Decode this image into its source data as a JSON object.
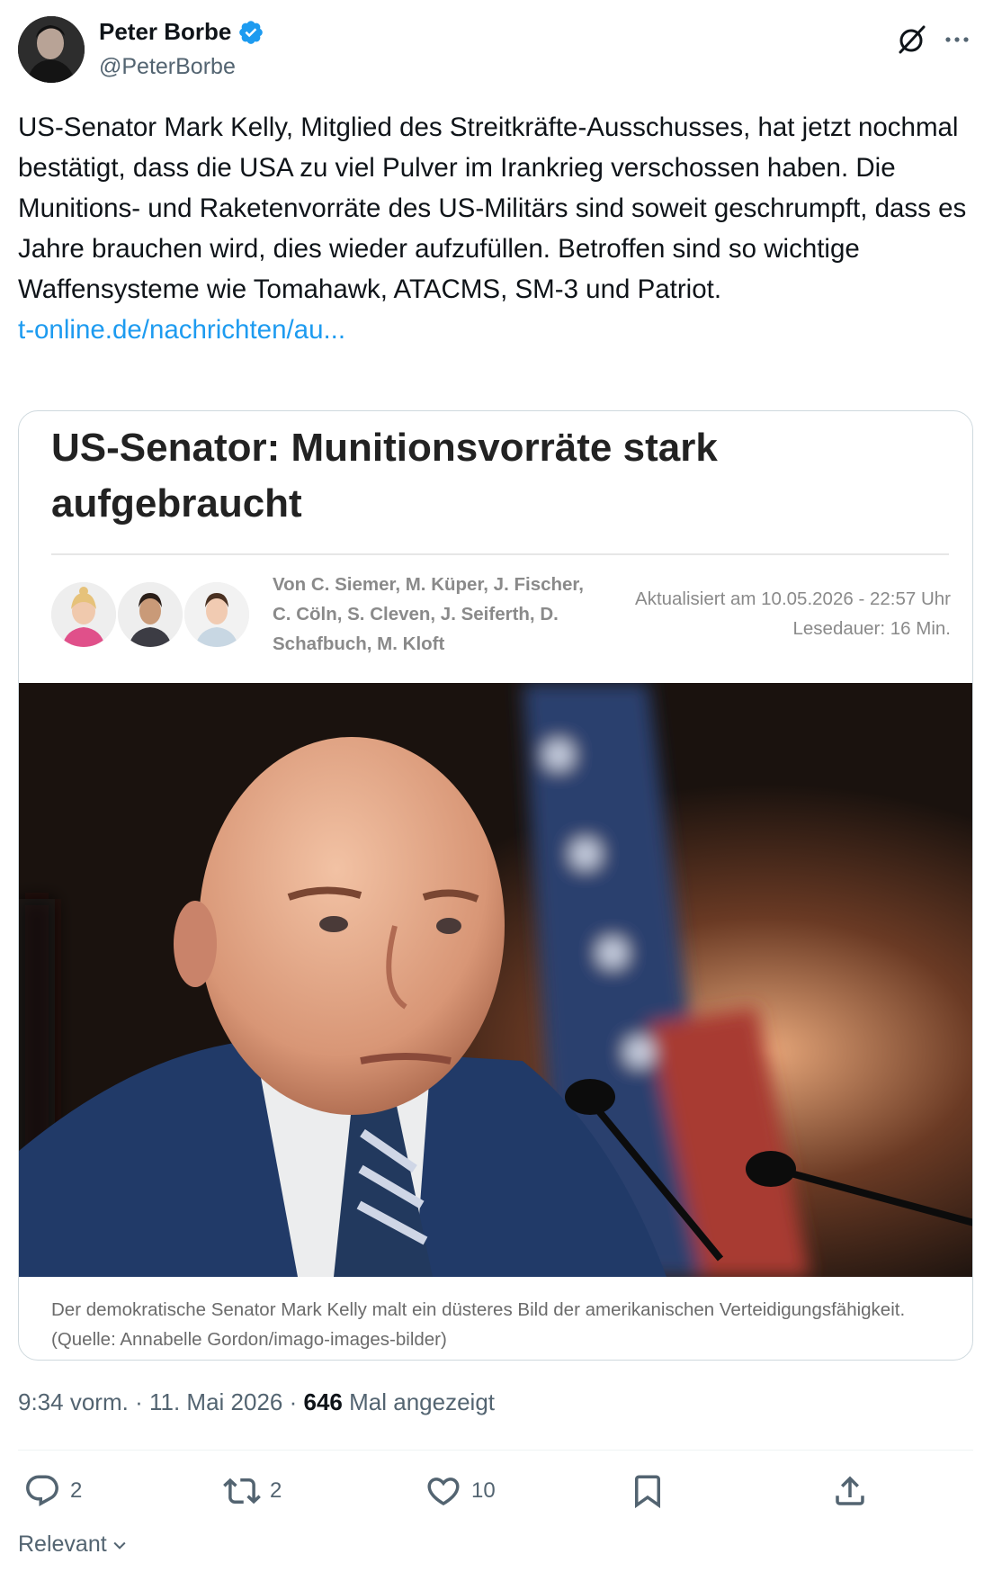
{
  "author": {
    "display_name": "Peter Borbe",
    "handle": "@PeterBorbe",
    "verified": true
  },
  "tweet": {
    "text": "US-Senator Mark Kelly, Mitglied des Streitkräfte-Ausschusses, hat jetzt nochmal bestätigt, dass die USA zu viel Pulver im Irankrieg verschossen haben. Die Munitions- und Raketenvorräte des US-Militärs sind soweit geschrumpft, dass es Jahre brauchen wird, dies wieder aufzufüllen. Betroffen sind so wichtige Waffensysteme wie Tomahawk, ATACMS, SM-3 und Patriot.",
    "link": "t-online.de/nachrichten/au..."
  },
  "card": {
    "headline": "US-Senator: Munitionsvorräte stark aufgebraucht",
    "byline": "Von C. Siemer, M. Küper, J. Fischer, C. Cöln, S. Cleven, J. Seiferth, D. Schafbuch, M. Kloft",
    "updated": "Aktualisiert am 10.05.2026 - 22:57 Uhr",
    "reading_time": "Lesedauer: 16 Min.",
    "caption": "Der demokratische Senator Mark Kelly malt ein düsteres Bild der amerikanischen Verteidigungsfähigkeit. (Quelle: Annabelle Gordon/imago-images-bilder)"
  },
  "meta": {
    "time": "9:34 vorm.",
    "sep1": "·",
    "date": "11. Mai 2026",
    "sep2": "·",
    "views_count": "646",
    "views_label": "Mal angezeigt"
  },
  "actions": {
    "replies": "2",
    "reposts": "2",
    "likes": "10"
  },
  "sort": {
    "label": "Relevant"
  },
  "colors": {
    "accent": "#1d9bf0",
    "text": "#0f1419",
    "muted": "#536471",
    "border": "#cfd9de"
  },
  "icons": [
    "verified-badge-icon",
    "grok-icon",
    "more-icon",
    "reply-icon",
    "repost-icon",
    "like-icon",
    "bookmark-icon",
    "share-icon",
    "chevron-down-icon"
  ]
}
